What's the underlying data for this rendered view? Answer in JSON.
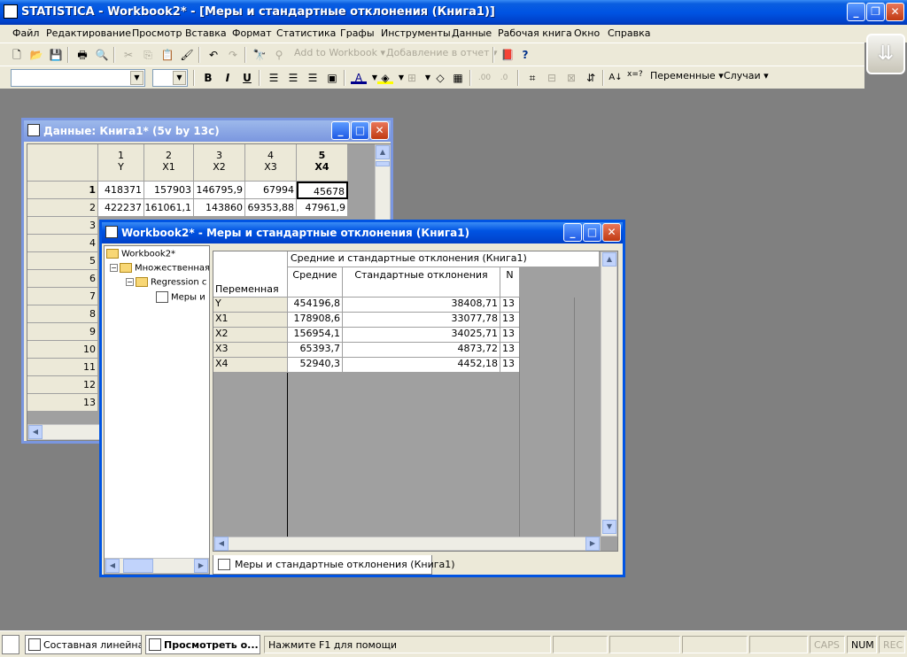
{
  "app": {
    "title": "STATISTICA - Workbook2* - [Меры и стандартные отклонения (Книга1)]",
    "window_buttons": {
      "minimize": "_",
      "restore": "❐",
      "close": "✕"
    }
  },
  "menu": [
    "Файл",
    "Редактирование",
    "Просмотр",
    "Вставка",
    "Формат",
    "Статистика",
    "Графы",
    "Инструменты",
    "Данные",
    "Рабочая книга",
    "Окно",
    "Справка"
  ],
  "toolbar1": {
    "icons": {
      "new": "🗋",
      "open": "📂",
      "save": "💾",
      "print": "🖶",
      "preview": "🔍",
      "cut": "✂",
      "copy": "⎘",
      "paste": "📋",
      "format_painter": "🖌",
      "undo": "↶",
      "redo": "↷",
      "binoculars": "🔭",
      "find": "⚲",
      "book": "📕",
      "help": "?"
    },
    "add_to_workbook": "Add to Workbook",
    "add_to_report": "Добавление в отчет"
  },
  "toolbar2": {
    "bold": "B",
    "italic": "I",
    "underline": "U",
    "variables_label": "Переменные",
    "cases_label": "Случаи",
    "font_size_hint": "x=?"
  },
  "data_window": {
    "title": "Данные: Книга1* (5v by 13c)",
    "columns": [
      {
        "num": "1",
        "name": "Y"
      },
      {
        "num": "2",
        "name": "X1"
      },
      {
        "num": "3",
        "name": "X2"
      },
      {
        "num": "4",
        "name": "X3"
      },
      {
        "num": "5",
        "name": "X4"
      }
    ],
    "row_numbers": [
      "1",
      "2",
      "3",
      "4",
      "5",
      "6",
      "7",
      "8",
      "9",
      "10",
      "11",
      "12",
      "13"
    ],
    "rows": [
      [
        "418371",
        "157903",
        "146795,9",
        "67994",
        "45678"
      ],
      [
        "422237",
        "161061,1",
        "143860",
        "69353,88",
        "47961,9"
      ]
    ]
  },
  "workbook_window": {
    "title": "Workbook2* - Меры и стандартные отклонения (Книга1)",
    "tree": {
      "root": "Workbook2*",
      "level1": "Множественная",
      "level2": "Regression с",
      "level3": "Меры и"
    },
    "table": {
      "group_header": "Средние и стандартные отклонения (Книга1)",
      "row_header": "Переменная",
      "col_headers": [
        "Средние",
        "Стандартные отклонения",
        "N"
      ],
      "rows": [
        {
          "var": "Y",
          "mean": "454196,8",
          "sd": "38408,71",
          "n": "13"
        },
        {
          "var": "X1",
          "mean": "178908,6",
          "sd": "33077,78",
          "n": "13"
        },
        {
          "var": "X2",
          "mean": "156954,1",
          "sd": "34025,71",
          "n": "13"
        },
        {
          "var": "X3",
          "mean": "65393,7",
          "sd": "4873,72",
          "n": "13"
        },
        {
          "var": "X4",
          "mean": "52940,3",
          "sd": "4452,18",
          "n": "13"
        }
      ]
    },
    "tab_label": "Меры и стандартные отклонения (Книга1)"
  },
  "statusbar": {
    "tasks": [
      "Составная линейна...",
      "Просмотреть о..."
    ],
    "help_text": "Нажмите F1 для помощи",
    "indicators": [
      "CAPS",
      "NUM",
      "REC"
    ]
  }
}
